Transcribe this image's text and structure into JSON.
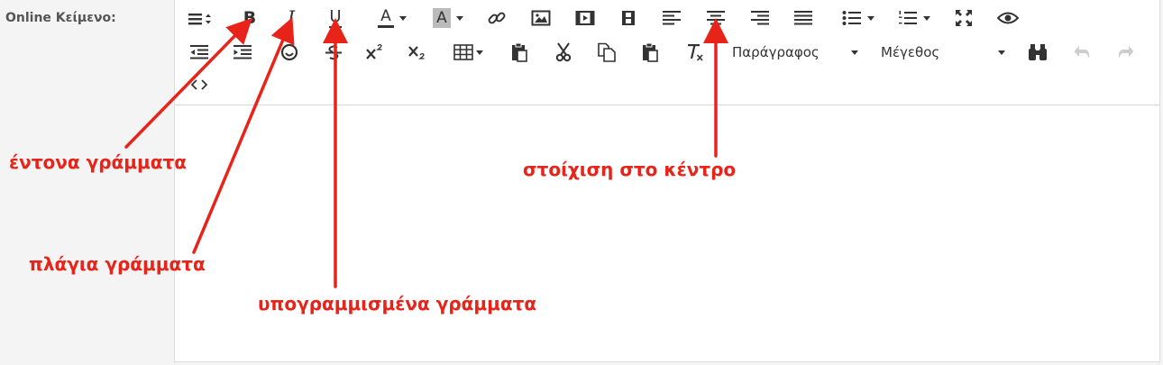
{
  "field": {
    "label": "Online Κείμενο:"
  },
  "toolbar": {
    "row1": [
      {
        "name": "format-menu-icon"
      },
      {
        "name": "bold-button",
        "text": "B"
      },
      {
        "name": "italic-button",
        "text": "I"
      },
      {
        "name": "underline-button",
        "text": "U"
      },
      {
        "name": "text-color-button",
        "text": "A"
      },
      {
        "name": "bg-color-button",
        "text": "A"
      },
      {
        "name": "link-icon"
      },
      {
        "name": "image-icon"
      },
      {
        "name": "media-icon"
      },
      {
        "name": "video-icon"
      },
      {
        "name": "align-left-icon"
      },
      {
        "name": "align-center-icon"
      },
      {
        "name": "align-right-icon"
      },
      {
        "name": "align-justify-icon"
      },
      {
        "name": "bullet-list-icon"
      },
      {
        "name": "numbered-list-icon"
      },
      {
        "name": "fullscreen-icon"
      },
      {
        "name": "preview-eye-icon"
      }
    ],
    "row2": [
      {
        "name": "outdent-icon"
      },
      {
        "name": "indent-icon"
      },
      {
        "name": "emoticon-icon"
      },
      {
        "name": "strikethrough-icon"
      },
      {
        "name": "superscript-icon"
      },
      {
        "name": "subscript-icon"
      },
      {
        "name": "table-icon"
      },
      {
        "name": "paste-icon"
      },
      {
        "name": "cut-icon"
      },
      {
        "name": "copy-icon"
      },
      {
        "name": "paste-text-icon"
      },
      {
        "name": "clear-format-icon"
      },
      {
        "name": "find-binoculars-icon"
      },
      {
        "name": "undo-icon"
      },
      {
        "name": "redo-icon"
      }
    ],
    "paragraph_select": "Παράγραφος",
    "size_select": "Μέγεθος",
    "row3": [
      {
        "name": "source-code-icon"
      }
    ]
  },
  "annotations": {
    "bold": "έντονα γράμματα",
    "italic": "πλάγια γράμματα",
    "underline": "υπογραμμισμένα γράμματα",
    "center": "στοίχιση στο κέντρο",
    "color": "#e8241a"
  }
}
